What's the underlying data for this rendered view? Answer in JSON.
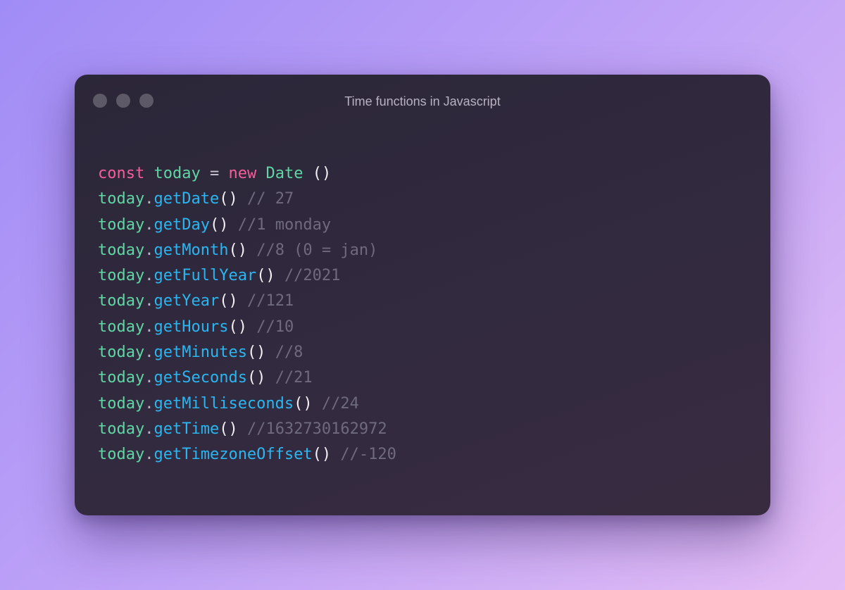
{
  "window": {
    "title": "Time functions in Javascript"
  },
  "colors": {
    "keyword": "#f75c9b",
    "identifier": "#5fd6a3",
    "method": "#29b6f1",
    "comment": "#6f6a7d",
    "punctuation": "#f4f2f7"
  },
  "code": {
    "declaration": {
      "keyword_const": "const",
      "variable": "today",
      "operator": "=",
      "keyword_new": "new",
      "class_name": "Date",
      "parens": " ()"
    },
    "object": "today",
    "calls": [
      {
        "method": "getDate",
        "comment": "// 27"
      },
      {
        "method": "getDay",
        "comment": "//1 monday"
      },
      {
        "method": "getMonth",
        "comment": "//8 (0 = jan)"
      },
      {
        "method": "getFullYear",
        "comment": "//2021"
      },
      {
        "method": "getYear",
        "comment": "//121"
      },
      {
        "method": "getHours",
        "comment": "//10"
      },
      {
        "method": "getMinutes",
        "comment": "//8"
      },
      {
        "method": "getSeconds",
        "comment": "//21"
      },
      {
        "method": "getMilliseconds",
        "comment": "//24"
      },
      {
        "method": "getTime",
        "comment": "//1632730162972"
      },
      {
        "method": "getTimezoneOffset",
        "comment": "//-120"
      }
    ]
  }
}
